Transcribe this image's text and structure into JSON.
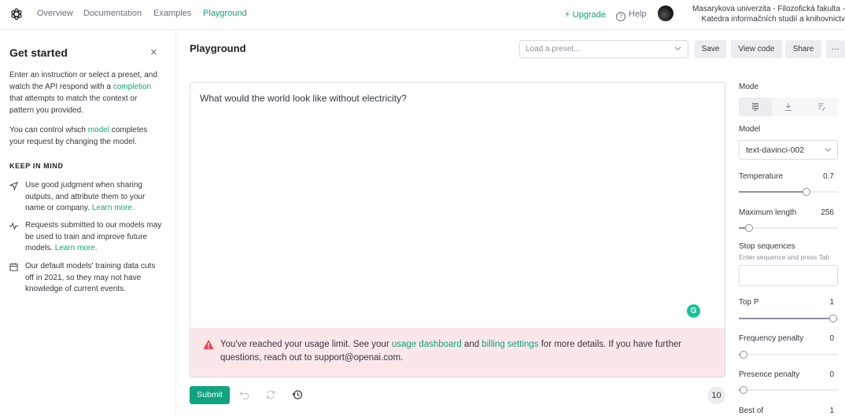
{
  "nav": {
    "links": [
      "Overview",
      "Documentation",
      "Examples",
      "Playground"
    ],
    "upgrade": "Upgrade",
    "help": "Help",
    "org_line1": "Masarykova univerzita - Filozofická fakulta -",
    "org_line2": "Katedra informačních studií a knihovnictv"
  },
  "sidebar": {
    "title": "Get started",
    "close": "×",
    "para1_a": "Enter an instruction or select a preset, and watch the API respond with a ",
    "para1_link": "completion",
    "para1_b": " that attempts to match the context or pattern you provided.",
    "para2_a": "You can control which ",
    "para2_link": "model",
    "para2_b": " completes your request by changing the model.",
    "keep_in_mind": "KEEP IN MIND",
    "tips": [
      {
        "text": "Use good judgment when sharing outputs, and attribute them to your name or company. ",
        "link": "Learn more."
      },
      {
        "text": "Requests submitted to our models may be used to train and improve future models. ",
        "link": "Learn more."
      },
      {
        "text": "Our default models' training data cuts off in 2021, so they may not have knowledge of current events.",
        "link": ""
      }
    ]
  },
  "main": {
    "title": "Playground",
    "preset_placeholder": "Load a preset...",
    "buttons": {
      "save": "Save",
      "view_code": "View code",
      "share": "Share",
      "more": "···"
    },
    "prompt": "What would the world look like without electricity?",
    "grammarly": "G",
    "alert": {
      "a": "You've reached your usage limit. See your ",
      "link1": "usage dashboard",
      "b": " and ",
      "link2": "billing settings",
      "c": " for more details. If you have further questions, reach out to support@openai.com."
    },
    "submit": "Submit",
    "token_count": "10"
  },
  "panel": {
    "mode_label": "Mode",
    "mode_selected": 0,
    "model_label": "Model",
    "model_value": "text-davinci-002",
    "temperature": {
      "label": "Temperature",
      "value": "0.7",
      "fraction": 0.7
    },
    "max_length": {
      "label": "Maximum length",
      "value": "256",
      "fraction": 0.06
    },
    "stop_label": "Stop sequences",
    "stop_hint": "Enter sequence and press Tab",
    "top_p": {
      "label": "Top P",
      "value": "1",
      "fraction": 1.0
    },
    "freq": {
      "label": "Frequency penalty",
      "value": "0",
      "fraction": 0.0
    },
    "presence": {
      "label": "Presence penalty",
      "value": "0",
      "fraction": 0.0
    },
    "best_of": {
      "label": "Best of",
      "value": "1"
    }
  },
  "colors": {
    "accent": "#10a37f",
    "alert_bg": "#fbe7ea",
    "alert_icon": "#ef4146"
  }
}
